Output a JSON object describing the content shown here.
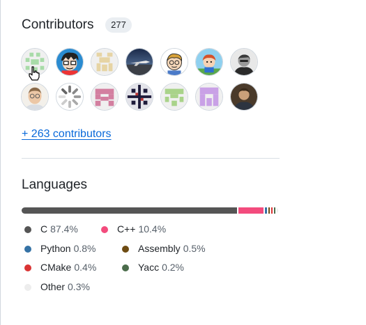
{
  "contributors": {
    "title": "Contributors",
    "count": "277",
    "more_link": "+ 263 contributors",
    "avatars": [
      {
        "name": "avatar-green-identicon"
      },
      {
        "name": "avatar-cartoon-glasses"
      },
      {
        "name": "avatar-beige-identicon"
      },
      {
        "name": "avatar-airplane"
      },
      {
        "name": "avatar-cartoon-blond"
      },
      {
        "name": "avatar-cartoon-redhead"
      },
      {
        "name": "avatar-bw-photo"
      },
      {
        "name": "avatar-man-glasses"
      },
      {
        "name": "avatar-loading-spinner"
      },
      {
        "name": "avatar-pink-identicon"
      },
      {
        "name": "avatar-dark-pattern"
      },
      {
        "name": "avatar-lightgreen-identicon"
      },
      {
        "name": "avatar-lavender-identicon"
      },
      {
        "name": "avatar-man-dark"
      }
    ]
  },
  "languages": {
    "title": "Languages",
    "items": [
      {
        "name": "C",
        "pct": "87.4%",
        "value": 87.4,
        "color": "#555555"
      },
      {
        "name": "C++",
        "pct": "10.4%",
        "value": 10.4,
        "color": "#f34b7d"
      },
      {
        "name": "Python",
        "pct": "0.8%",
        "value": 0.8,
        "color": "#3572A5"
      },
      {
        "name": "Assembly",
        "pct": "0.5%",
        "value": 0.5,
        "color": "#6E4C13"
      },
      {
        "name": "CMake",
        "pct": "0.4%",
        "value": 0.4,
        "color": "#DA3434"
      },
      {
        "name": "Yacc",
        "pct": "0.2%",
        "value": 0.2,
        "color": "#4B6C4B"
      },
      {
        "name": "Other",
        "pct": "0.3%",
        "value": 0.3,
        "color": "#ededed"
      }
    ]
  }
}
